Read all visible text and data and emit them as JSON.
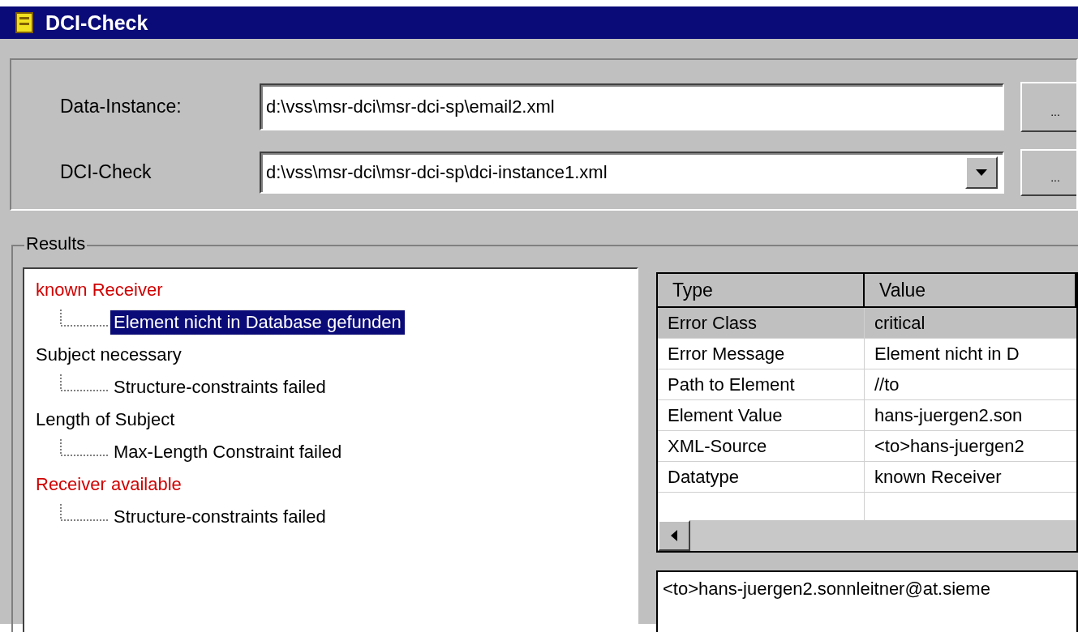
{
  "window": {
    "title": "DCI-Check"
  },
  "fields": [
    {
      "label": "Data-Instance:",
      "value": "d:\\vss\\msr-dci\\msr-dci-sp\\email2.xml",
      "kind": "text",
      "button": "..."
    },
    {
      "label": "DCI-Check",
      "value": "d:\\vss\\msr-dci\\msr-dci-sp\\dci-instance1.xml",
      "kind": "combo",
      "button": "..."
    }
  ],
  "results": {
    "title": "Results",
    "tree": [
      {
        "label": "known Receiver",
        "color": "#d00000",
        "children": [
          {
            "label": "Element nicht in Database gefunden",
            "selected": true
          }
        ]
      },
      {
        "label": "Subject necessary",
        "color": "#000000",
        "children": [
          {
            "label": "Structure-constraints failed",
            "selected": false
          }
        ]
      },
      {
        "label": "Length of Subject",
        "color": "#000000",
        "children": [
          {
            "label": "Max-Length Constraint failed",
            "selected": false
          }
        ]
      },
      {
        "label": "Receiver available",
        "color": "#d00000",
        "children": [
          {
            "label": "Structure-constraints failed",
            "selected": false
          }
        ]
      }
    ]
  },
  "details": {
    "columns": [
      "Type",
      "Value"
    ],
    "rows": [
      {
        "type": "Error Class",
        "value": "critical",
        "selected": true
      },
      {
        "type": "Error Message",
        "value": " Element nicht in D",
        "selected": false
      },
      {
        "type": "Path to Element",
        "value": "//to",
        "selected": false
      },
      {
        "type": "Element Value",
        "value": "hans-juergen2.son",
        "selected": false
      },
      {
        "type": "XML-Source",
        "value": "<to>hans-juergen2",
        "selected": false
      },
      {
        "type": "Datatype",
        "value": "known Receiver",
        "selected": false
      }
    ],
    "source": "<to>hans-juergen2.sonnleitner@at.sieme"
  }
}
